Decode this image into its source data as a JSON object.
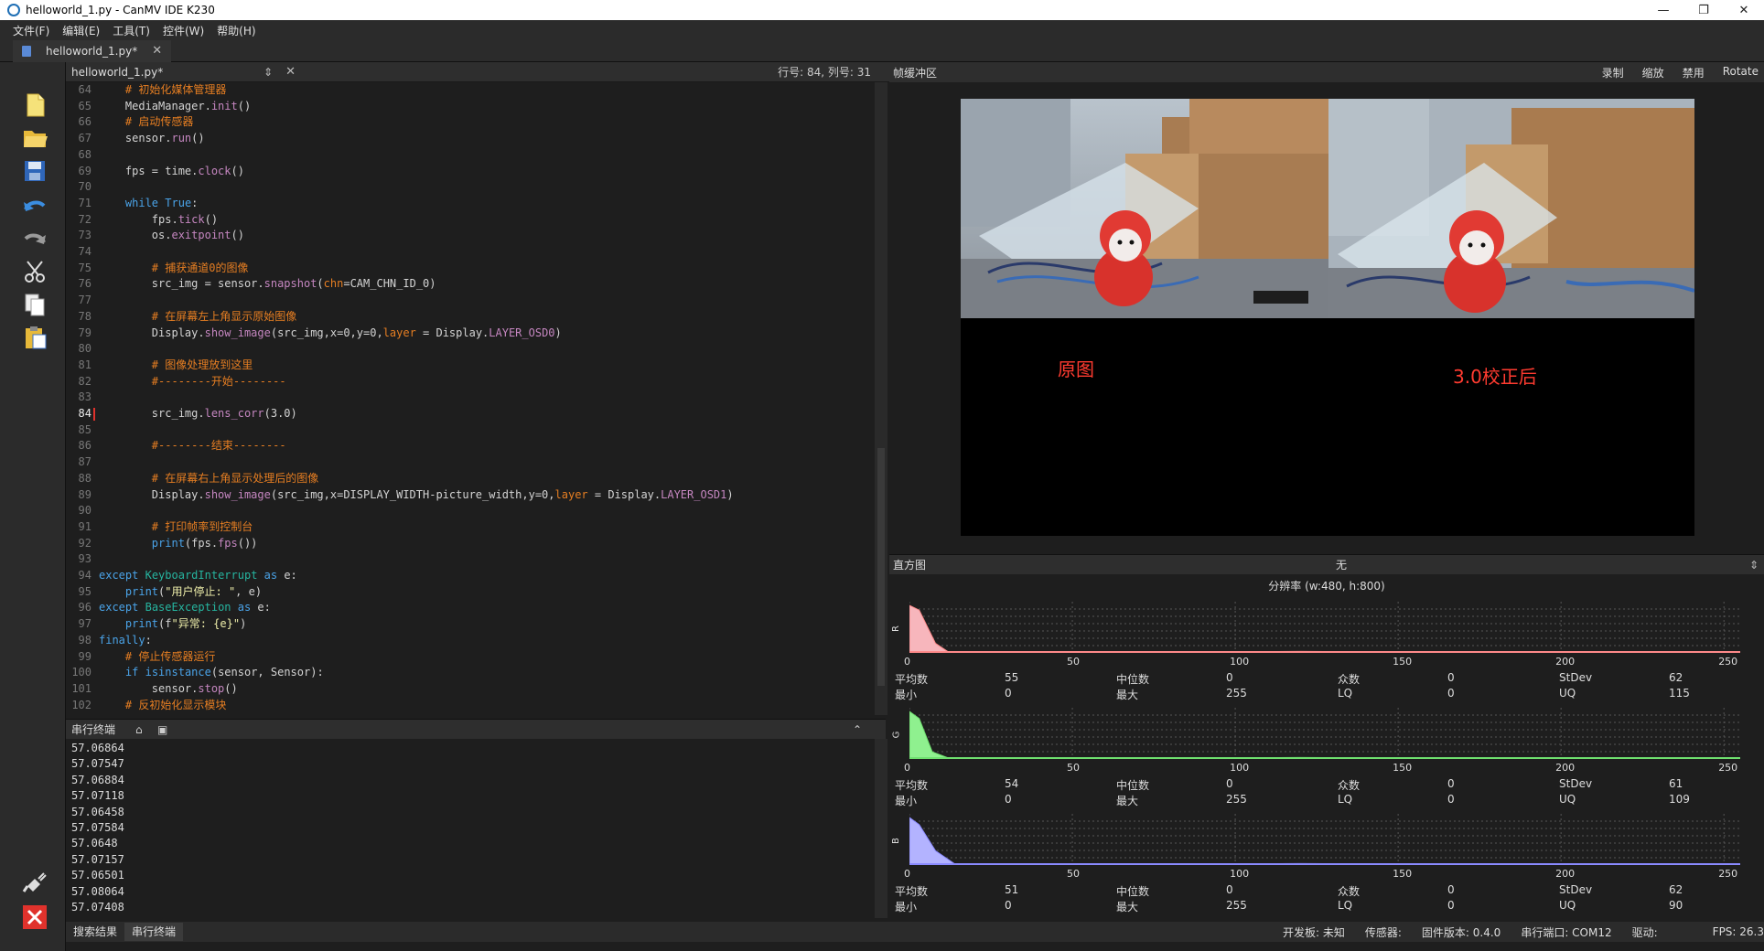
{
  "window": {
    "title": "helloworld_1.py - CanMV IDE K230",
    "controls": [
      "—",
      "❐",
      "✕"
    ]
  },
  "menu": [
    "文件(F)",
    "编辑(E)",
    "工具(T)",
    "控件(W)",
    "帮助(H)"
  ],
  "doc_tab": {
    "label": "helloworld_1.py*",
    "close": "✕"
  },
  "editor": {
    "file_label": "helloworld_1.py*",
    "arrows": "⇕",
    "close": "✕",
    "cursor_pos": "行号: 84, 列号: 31",
    "current_line": "84"
  },
  "code_lines": [
    {
      "n": "64",
      "code": "    # 初始化媒体管理器"
    },
    {
      "n": "65",
      "code": "    MediaManager.init()"
    },
    {
      "n": "66",
      "code": "    # 启动传感器"
    },
    {
      "n": "67",
      "code": "    sensor.run()"
    },
    {
      "n": "68",
      "code": ""
    },
    {
      "n": "69",
      "code": "    fps = time.clock()"
    },
    {
      "n": "70",
      "code": ""
    },
    {
      "n": "71",
      "code": "    while True:"
    },
    {
      "n": "72",
      "code": "        fps.tick()"
    },
    {
      "n": "73",
      "code": "        os.exitpoint()"
    },
    {
      "n": "74",
      "code": ""
    },
    {
      "n": "75",
      "code": "        # 捕获通道0的图像"
    },
    {
      "n": "76",
      "code": "        src_img = sensor.snapshot(chn=CAM_CHN_ID_0)"
    },
    {
      "n": "77",
      "code": ""
    },
    {
      "n": "78",
      "code": "        # 在屏幕左上角显示原始图像"
    },
    {
      "n": "79",
      "code": "        Display.show_image(src_img,x=0,y=0,layer = Display.LAYER_OSD0)"
    },
    {
      "n": "80",
      "code": ""
    },
    {
      "n": "81",
      "code": "        # 图像处理放到这里"
    },
    {
      "n": "82",
      "code": "        #--------开始--------"
    },
    {
      "n": "83",
      "code": ""
    },
    {
      "n": "84",
      "code": "        src_img.lens_corr(3.0)"
    },
    {
      "n": "85",
      "code": ""
    },
    {
      "n": "86",
      "code": "        #--------结束--------"
    },
    {
      "n": "87",
      "code": ""
    },
    {
      "n": "88",
      "code": "        # 在屏幕右上角显示处理后的图像"
    },
    {
      "n": "89",
      "code": "        Display.show_image(src_img,x=DISPLAY_WIDTH-picture_width,y=0,layer = Display.LAYER_OSD1)"
    },
    {
      "n": "90",
      "code": ""
    },
    {
      "n": "91",
      "code": "        # 打印帧率到控制台"
    },
    {
      "n": "92",
      "code": "        print(fps.fps())"
    },
    {
      "n": "93",
      "code": ""
    },
    {
      "n": "94",
      "code": "except KeyboardInterrupt as e:"
    },
    {
      "n": "95",
      "code": "    print(\"用户停止: \", e)"
    },
    {
      "n": "96",
      "code": "except BaseException as e:"
    },
    {
      "n": "97",
      "code": "    print(f\"异常: {e}\")"
    },
    {
      "n": "98",
      "code": "finally:"
    },
    {
      "n": "99",
      "code": "    # 停止传感器运行"
    },
    {
      "n": "100",
      "code": "    if isinstance(sensor, Sensor):"
    },
    {
      "n": "101",
      "code": "        sensor.stop()"
    },
    {
      "n": "102",
      "code": "    # 反初始化显示模块"
    }
  ],
  "terminal": {
    "title": "串行终端",
    "lines": [
      "57.06864",
      "57.07547",
      "57.06884",
      "57.07118",
      "57.06458",
      "57.07584",
      "57.0648",
      "57.07157",
      "57.06501",
      "57.08064",
      "57.07408"
    ]
  },
  "bottom_tabs": [
    "搜索结果",
    "串行终端"
  ],
  "status": {
    "board": "开发板: 未知",
    "sensor": "传感器:",
    "firmware": "固件版本: 0.4.0",
    "port": "串行端口: COM12",
    "driver": "驱动:",
    "fps": "FPS:  26.3"
  },
  "framebuffer": {
    "title": "帧缓冲区",
    "actions": [
      "录制",
      "缩放",
      "禁用",
      "Rotate"
    ],
    "label_left": "原图",
    "label_right": "3.0校正后"
  },
  "histogram": {
    "title": "直方图",
    "mode": "无",
    "resolution": "分辨率 (w:480, h:800)",
    "ticks": [
      "0",
      "50",
      "100",
      "150",
      "200",
      "250"
    ],
    "stat_labels": {
      "mean": "平均数",
      "median": "中位数",
      "mode": "众数",
      "stdev": "StDev",
      "min": "最小",
      "max": "最大",
      "lq": "LQ",
      "uq": "UQ"
    },
    "channels": [
      {
        "name": "R",
        "color": "#ff8a8a",
        "fill": "#f7b6bc",
        "mean": "55",
        "median": "0",
        "mode": "0",
        "stdev": "62",
        "min": "0",
        "max": "255",
        "lq": "0",
        "uq": "115"
      },
      {
        "name": "G",
        "color": "#6fe06f",
        "fill": "#8ff08f",
        "mean": "54",
        "median": "0",
        "mode": "0",
        "stdev": "61",
        "min": "0",
        "max": "255",
        "lq": "0",
        "uq": "109"
      },
      {
        "name": "B",
        "color": "#8a8aff",
        "fill": "#b3b3ff",
        "mean": "51",
        "median": "0",
        "mode": "0",
        "stdev": "62",
        "min": "0",
        "max": "255",
        "lq": "0",
        "uq": "90"
      }
    ]
  }
}
